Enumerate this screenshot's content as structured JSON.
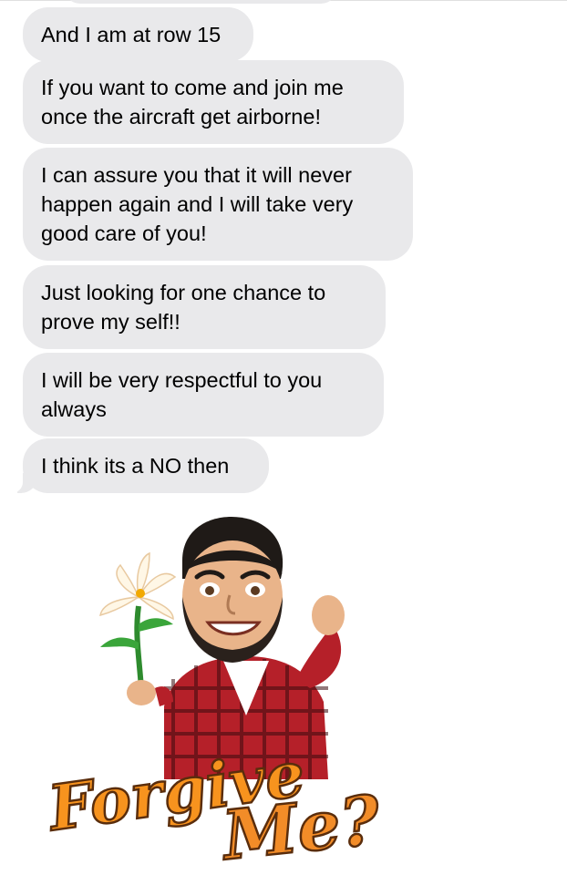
{
  "messages": [
    {
      "text": "And I am at row 15"
    },
    {
      "text": "If you want to come and join me once the aircraft get airborne!"
    },
    {
      "text": "I can assure you that it will never happen again and I will take very good care of you!"
    },
    {
      "text": "Just looking for one chance to prove my self!!"
    },
    {
      "text": "I will be very respectful to you always"
    },
    {
      "text": "I think its a NO then"
    }
  ],
  "sticker": {
    "caption_line1": "Forgive",
    "caption_line2": "Me?",
    "colors": {
      "text_orange": "#f7931e",
      "text_outline": "#5a2d0c",
      "shirt_red": "#c0262d"
    }
  }
}
